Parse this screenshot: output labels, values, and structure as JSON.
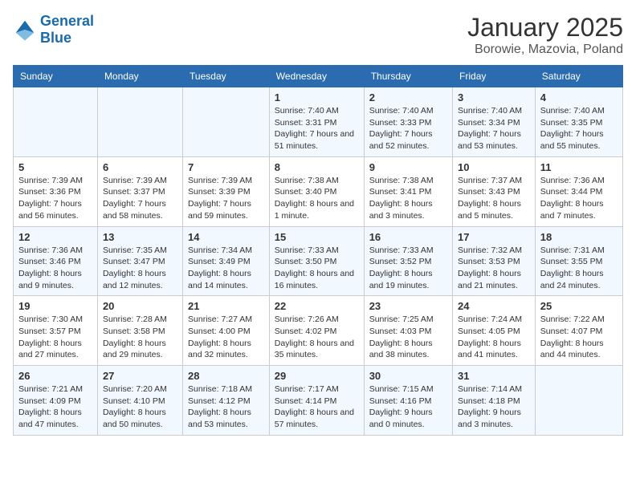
{
  "header": {
    "logo_line1": "General",
    "logo_line2": "Blue",
    "title": "January 2025",
    "subtitle": "Borowie, Mazovia, Poland"
  },
  "weekdays": [
    "Sunday",
    "Monday",
    "Tuesday",
    "Wednesday",
    "Thursday",
    "Friday",
    "Saturday"
  ],
  "weeks": [
    {
      "days": [
        {
          "num": "",
          "info": "",
          "empty": true
        },
        {
          "num": "",
          "info": "",
          "empty": true
        },
        {
          "num": "",
          "info": "",
          "empty": true
        },
        {
          "num": "1",
          "info": "Sunrise: 7:40 AM\nSunset: 3:31 PM\nDaylight: 7 hours and 51 minutes."
        },
        {
          "num": "2",
          "info": "Sunrise: 7:40 AM\nSunset: 3:33 PM\nDaylight: 7 hours and 52 minutes."
        },
        {
          "num": "3",
          "info": "Sunrise: 7:40 AM\nSunset: 3:34 PM\nDaylight: 7 hours and 53 minutes."
        },
        {
          "num": "4",
          "info": "Sunrise: 7:40 AM\nSunset: 3:35 PM\nDaylight: 7 hours and 55 minutes."
        }
      ]
    },
    {
      "days": [
        {
          "num": "5",
          "info": "Sunrise: 7:39 AM\nSunset: 3:36 PM\nDaylight: 7 hours and 56 minutes."
        },
        {
          "num": "6",
          "info": "Sunrise: 7:39 AM\nSunset: 3:37 PM\nDaylight: 7 hours and 58 minutes."
        },
        {
          "num": "7",
          "info": "Sunrise: 7:39 AM\nSunset: 3:39 PM\nDaylight: 7 hours and 59 minutes."
        },
        {
          "num": "8",
          "info": "Sunrise: 7:38 AM\nSunset: 3:40 PM\nDaylight: 8 hours and 1 minute."
        },
        {
          "num": "9",
          "info": "Sunrise: 7:38 AM\nSunset: 3:41 PM\nDaylight: 8 hours and 3 minutes."
        },
        {
          "num": "10",
          "info": "Sunrise: 7:37 AM\nSunset: 3:43 PM\nDaylight: 8 hours and 5 minutes."
        },
        {
          "num": "11",
          "info": "Sunrise: 7:36 AM\nSunset: 3:44 PM\nDaylight: 8 hours and 7 minutes."
        }
      ]
    },
    {
      "days": [
        {
          "num": "12",
          "info": "Sunrise: 7:36 AM\nSunset: 3:46 PM\nDaylight: 8 hours and 9 minutes."
        },
        {
          "num": "13",
          "info": "Sunrise: 7:35 AM\nSunset: 3:47 PM\nDaylight: 8 hours and 12 minutes."
        },
        {
          "num": "14",
          "info": "Sunrise: 7:34 AM\nSunset: 3:49 PM\nDaylight: 8 hours and 14 minutes."
        },
        {
          "num": "15",
          "info": "Sunrise: 7:33 AM\nSunset: 3:50 PM\nDaylight: 8 hours and 16 minutes."
        },
        {
          "num": "16",
          "info": "Sunrise: 7:33 AM\nSunset: 3:52 PM\nDaylight: 8 hours and 19 minutes."
        },
        {
          "num": "17",
          "info": "Sunrise: 7:32 AM\nSunset: 3:53 PM\nDaylight: 8 hours and 21 minutes."
        },
        {
          "num": "18",
          "info": "Sunrise: 7:31 AM\nSunset: 3:55 PM\nDaylight: 8 hours and 24 minutes."
        }
      ]
    },
    {
      "days": [
        {
          "num": "19",
          "info": "Sunrise: 7:30 AM\nSunset: 3:57 PM\nDaylight: 8 hours and 27 minutes."
        },
        {
          "num": "20",
          "info": "Sunrise: 7:28 AM\nSunset: 3:58 PM\nDaylight: 8 hours and 29 minutes."
        },
        {
          "num": "21",
          "info": "Sunrise: 7:27 AM\nSunset: 4:00 PM\nDaylight: 8 hours and 32 minutes."
        },
        {
          "num": "22",
          "info": "Sunrise: 7:26 AM\nSunset: 4:02 PM\nDaylight: 8 hours and 35 minutes."
        },
        {
          "num": "23",
          "info": "Sunrise: 7:25 AM\nSunset: 4:03 PM\nDaylight: 8 hours and 38 minutes."
        },
        {
          "num": "24",
          "info": "Sunrise: 7:24 AM\nSunset: 4:05 PM\nDaylight: 8 hours and 41 minutes."
        },
        {
          "num": "25",
          "info": "Sunrise: 7:22 AM\nSunset: 4:07 PM\nDaylight: 8 hours and 44 minutes."
        }
      ]
    },
    {
      "days": [
        {
          "num": "26",
          "info": "Sunrise: 7:21 AM\nSunset: 4:09 PM\nDaylight: 8 hours and 47 minutes."
        },
        {
          "num": "27",
          "info": "Sunrise: 7:20 AM\nSunset: 4:10 PM\nDaylight: 8 hours and 50 minutes."
        },
        {
          "num": "28",
          "info": "Sunrise: 7:18 AM\nSunset: 4:12 PM\nDaylight: 8 hours and 53 minutes."
        },
        {
          "num": "29",
          "info": "Sunrise: 7:17 AM\nSunset: 4:14 PM\nDaylight: 8 hours and 57 minutes."
        },
        {
          "num": "30",
          "info": "Sunrise: 7:15 AM\nSunset: 4:16 PM\nDaylight: 9 hours and 0 minutes."
        },
        {
          "num": "31",
          "info": "Sunrise: 7:14 AM\nSunset: 4:18 PM\nDaylight: 9 hours and 3 minutes."
        },
        {
          "num": "",
          "info": "",
          "empty": true
        }
      ]
    }
  ]
}
